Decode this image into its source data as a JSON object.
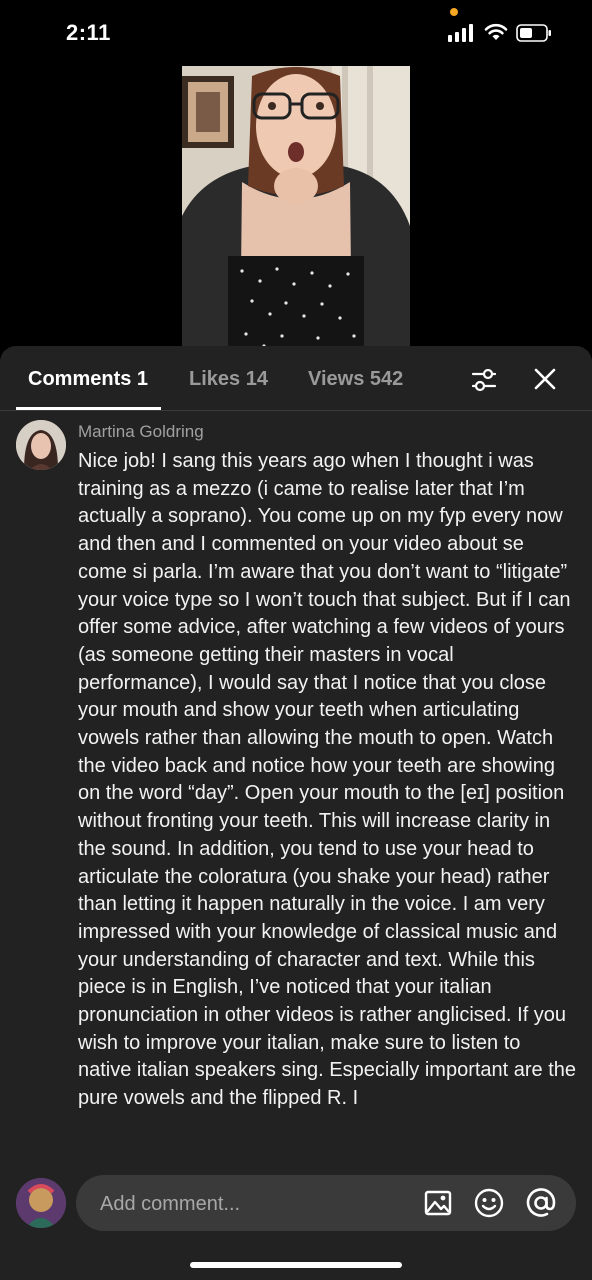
{
  "status_bar": {
    "time": "2:11",
    "icons": [
      "signal-icon",
      "wifi-icon",
      "battery-icon"
    ],
    "privacy_indicator_color": "#f5a623"
  },
  "video": {
    "description_icon": "video-thumbnail"
  },
  "tabs": [
    {
      "label": "Comments 1",
      "active": true
    },
    {
      "label": "Likes 14",
      "active": false
    },
    {
      "label": "Views 542",
      "active": false
    }
  ],
  "header_icons": [
    "filter-icon",
    "close-icon"
  ],
  "comment": {
    "author": "Martina Goldring",
    "text": "Nice job! I sang this years ago when I thought i was training as a mezzo (i came to realise later that I’m actually a soprano). You come up on my fyp every now and then and I commented on your video about se come si parla. I’m aware that you don’t want to “litigate” your voice type so I won’t touch that subject. But if I can offer some advice, after watching a few videos of yours (as someone getting their masters in vocal performance), I would say that I notice that you close your mouth and show your teeth when articulating vowels rather than allowing the mouth to open. Watch the video back and notice how your teeth are showing on the word “day”. Open your mouth to the [eɪ] position without fronting your teeth. This will increase clarity in the sound. In addition, you tend to use your head to articulate the coloratura (you shake your head) rather than letting it happen naturally in the voice. I am very impressed with your knowledge of classical music and your understanding of character and text. While this piece is in English, I’ve noticed that your italian pronunciation in other videos is rather anglicised. If you wish to improve your italian, make sure to listen to native italian speakers sing. Especially important are the pure vowels and the flipped R. I"
  },
  "composer": {
    "placeholder": "Add comment...",
    "icons": [
      "image-icon",
      "emoji-icon",
      "mention-icon"
    ]
  },
  "colors": {
    "sheet_background": "#222222",
    "input_background": "#3a3a3a",
    "active_tab": "#ffffff",
    "inactive_tab": "#9a9a9a"
  }
}
